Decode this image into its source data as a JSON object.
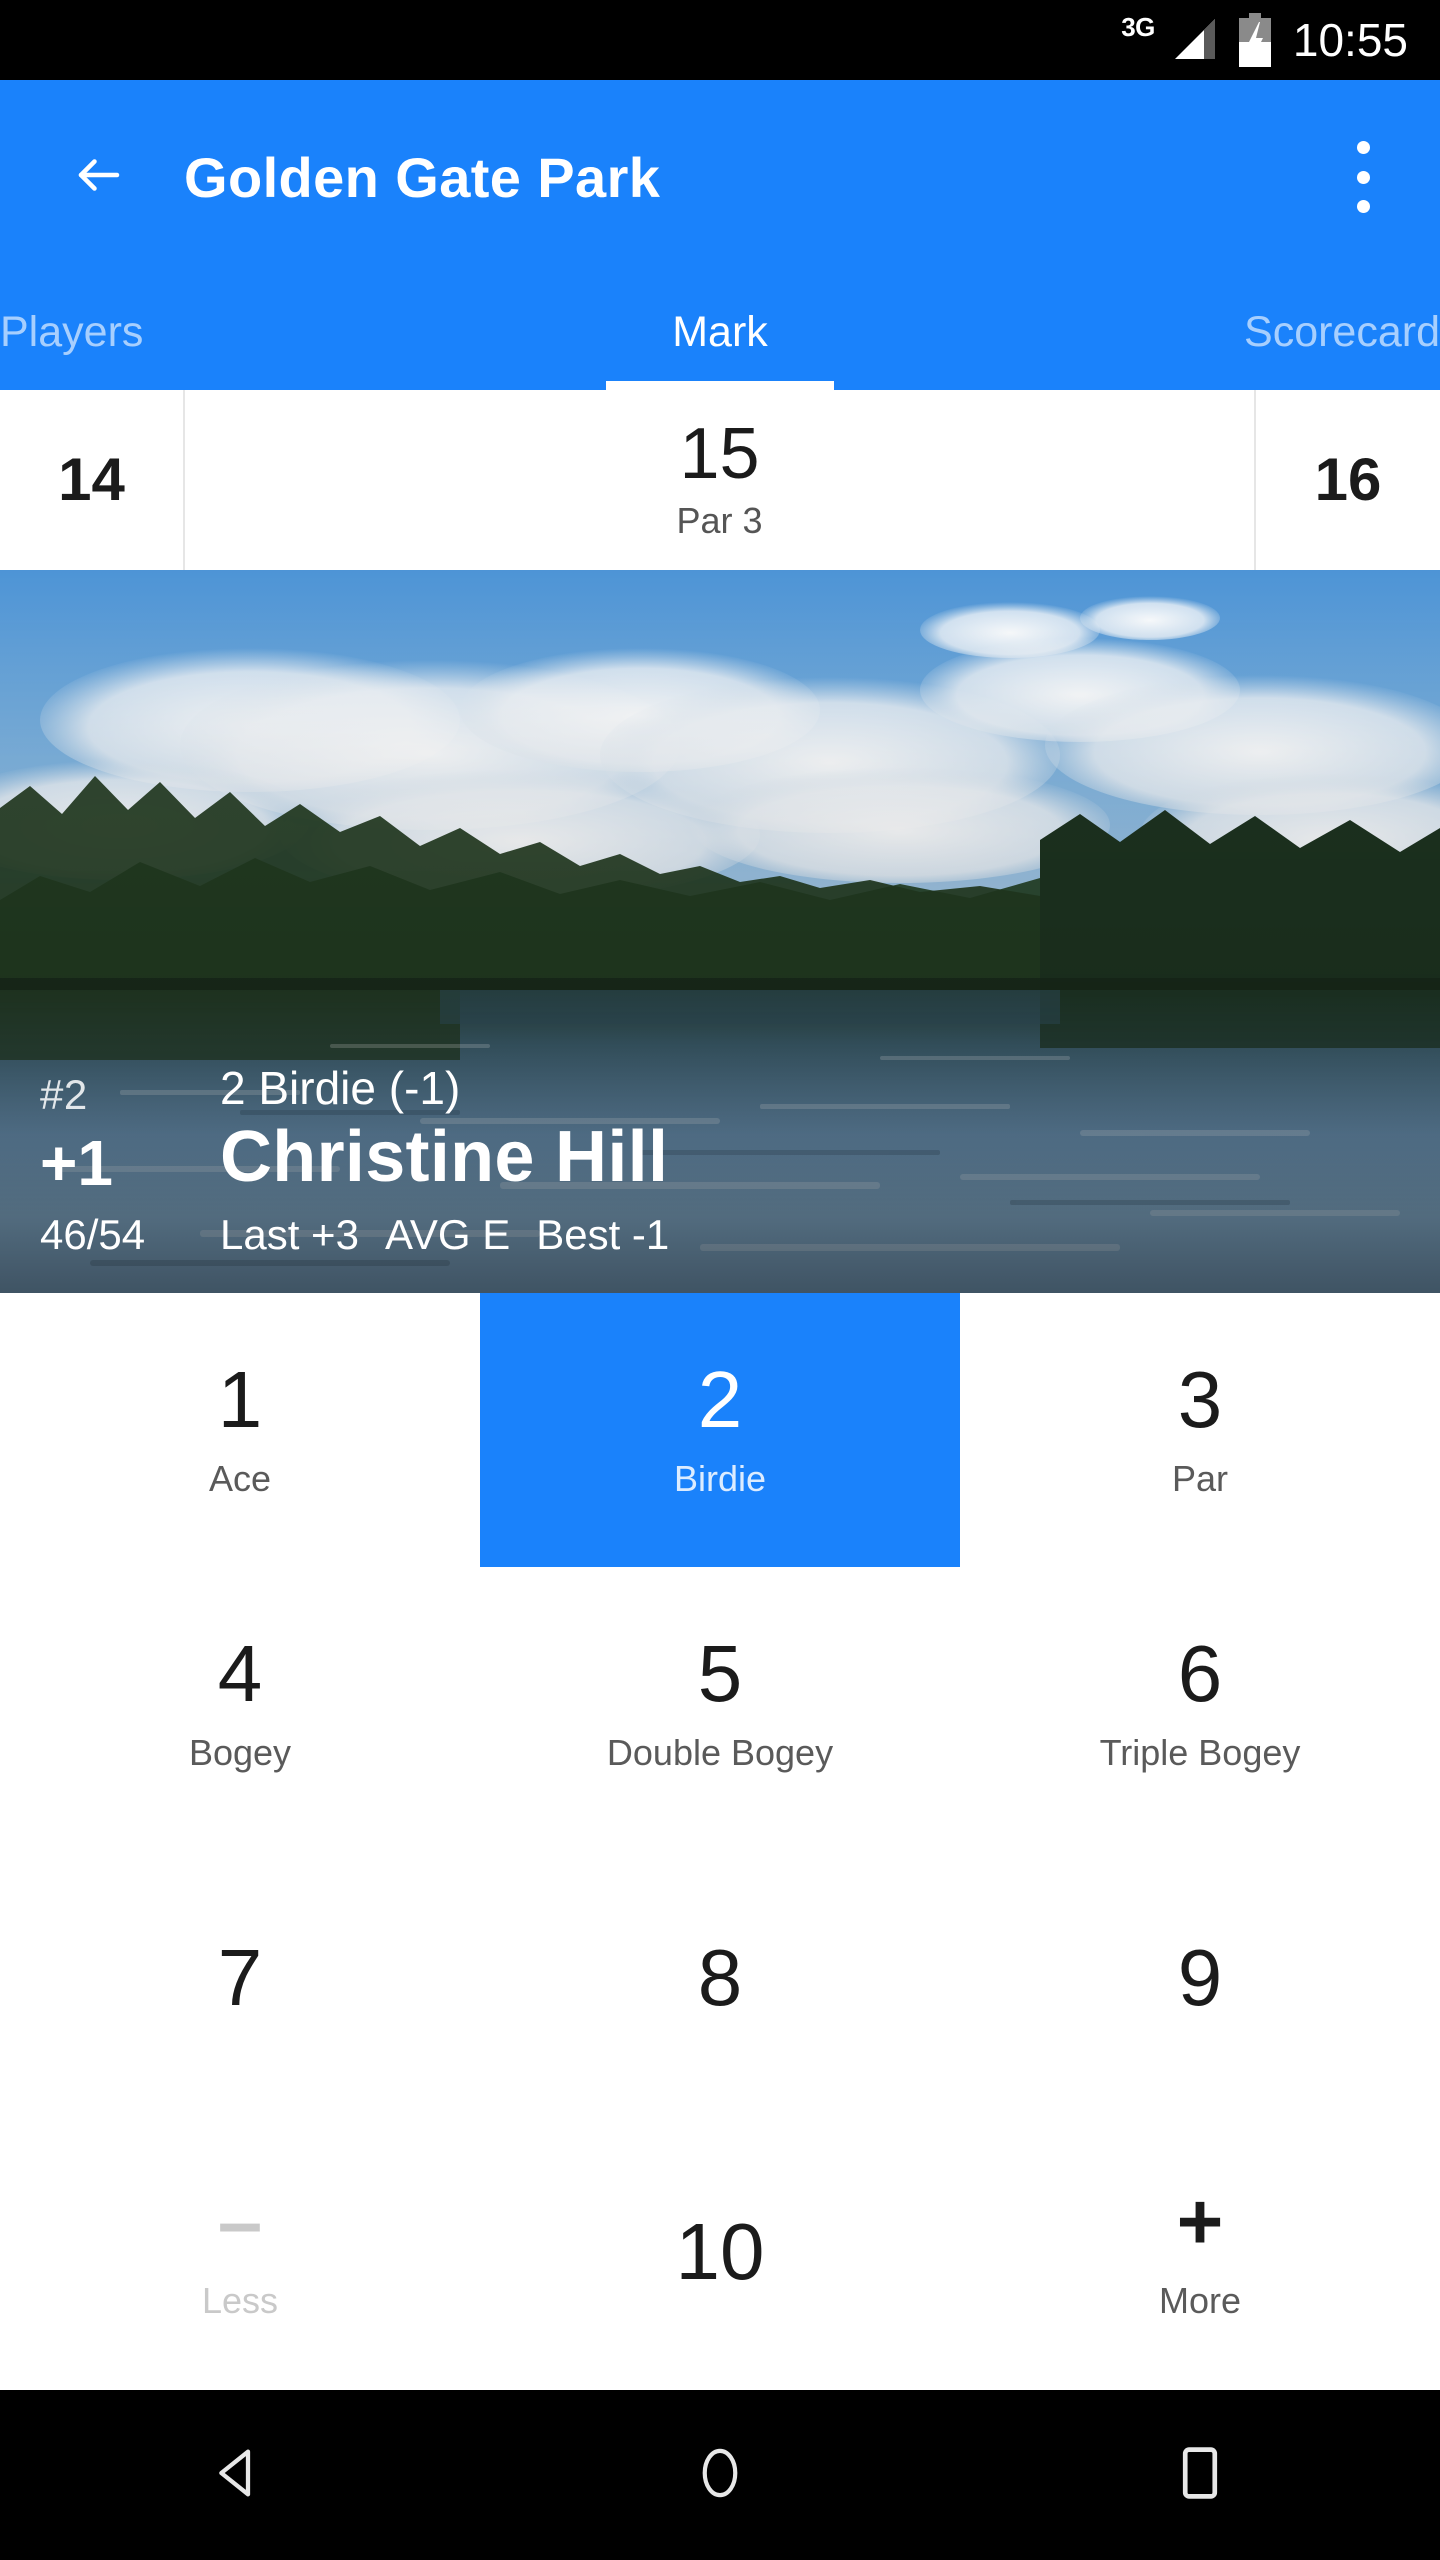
{
  "statusbar": {
    "network": "3G",
    "time": "10:55",
    "signal_icon": "signal-bars-icon",
    "battery_icon": "battery-charging-icon"
  },
  "appbar": {
    "back_icon": "arrow-back-icon",
    "title": "Golden Gate Park",
    "overflow_icon": "more-vert-icon"
  },
  "tabs": [
    {
      "label": "Players",
      "active": false
    },
    {
      "label": "Mark",
      "active": true
    },
    {
      "label": "Scorecard",
      "active": false
    }
  ],
  "holes": {
    "prev": "14",
    "current": "15",
    "current_par": "Par 3",
    "next": "16"
  },
  "player": {
    "rank": "#2",
    "score_label": "2 Birdie (-1)",
    "total": "+1",
    "name": "Christine Hill",
    "holes_played": "46/54",
    "last": "Last +3",
    "avg": "AVG E",
    "best": "Best -1"
  },
  "keypad": {
    "rows": [
      [
        {
          "num": "1",
          "label": "Ace",
          "state": "normal"
        },
        {
          "num": "2",
          "label": "Birdie",
          "state": "selected"
        },
        {
          "num": "3",
          "label": "Par",
          "state": "normal"
        }
      ],
      [
        {
          "num": "4",
          "label": "Bogey",
          "state": "normal"
        },
        {
          "num": "5",
          "label": "Double Bogey",
          "state": "normal"
        },
        {
          "num": "6",
          "label": "Triple Bogey",
          "state": "normal"
        }
      ],
      [
        {
          "num": "7",
          "label": "",
          "state": "normal"
        },
        {
          "num": "8",
          "label": "",
          "state": "normal"
        },
        {
          "num": "9",
          "label": "",
          "state": "normal"
        }
      ],
      [
        {
          "num": "–",
          "label": "Less",
          "state": "disabled"
        },
        {
          "num": "10",
          "label": "",
          "state": "normal"
        },
        {
          "num": "+",
          "label": "More",
          "state": "normal"
        }
      ]
    ]
  },
  "navbar": {
    "back_icon": "nav-back-triangle-icon",
    "home_icon": "nav-home-circle-icon",
    "recents_icon": "nav-recents-square-icon"
  },
  "colors": {
    "accent": "#1a82fb",
    "statusbar_bg": "#000000",
    "text_primary": "#1b1b1b",
    "text_secondary": "#5a5a5a",
    "disabled": "#c9c9c9"
  }
}
